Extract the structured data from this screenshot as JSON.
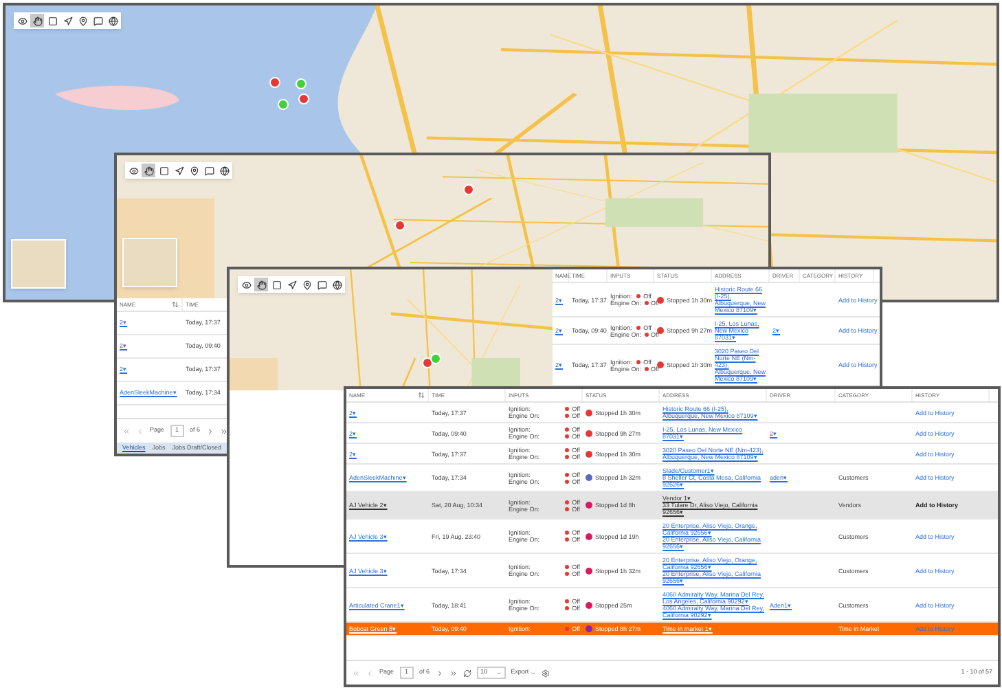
{
  "windows": [
    {
      "kind": "map_only",
      "tools": [
        {
          "selected": false
        },
        {
          "selected": true
        },
        {
          "selected": false
        },
        {
          "selected": false
        },
        {
          "selected": false
        },
        {
          "selected": false
        },
        {
          "selected": false
        }
      ],
      "markers": [
        {
          "color": "#e53935"
        },
        {
          "color": "#43d13a"
        },
        {
          "color": "#e53935"
        },
        {
          "color": "#43d13a"
        }
      ]
    },
    {
      "kind": "map_table",
      "tools": [
        {
          "selected": false
        },
        {
          "selected": true
        },
        {
          "selected": false
        },
        {
          "selected": false
        },
        {
          "selected": false
        },
        {
          "selected": false
        },
        {
          "selected": false
        }
      ],
      "markers": [
        {
          "color": "#e53935"
        },
        {
          "color": "#e53935"
        }
      ],
      "columns": [
        "NAME",
        "TIME"
      ],
      "rows": [
        {
          "name": "2▾",
          "time": "Today, 17:37"
        },
        {
          "name": "2▾",
          "time": "Today, 09:40"
        },
        {
          "name": "2▾",
          "time": "Today, 17:37"
        },
        {
          "name": "AdenSleekMachine▾",
          "time": "Today, 17:34"
        }
      ],
      "pager": {
        "page_label": "Page",
        "page": "1",
        "of": "of 6"
      },
      "tabs": [
        {
          "label": "Vehicles",
          "selected": true
        },
        {
          "label": "Jobs",
          "selected": false
        },
        {
          "label": "Jobs Draft/Closed",
          "selected": false
        }
      ]
    },
    {
      "kind": "split",
      "tools": [
        {
          "selected": false
        },
        {
          "selected": true
        },
        {
          "selected": false
        },
        {
          "selected": false
        },
        {
          "selected": false
        },
        {
          "selected": false
        },
        {
          "selected": false
        }
      ],
      "markers": [
        {
          "color": "#e53935"
        },
        {
          "color": "#43d13a"
        }
      ],
      "columns": [
        "NAME",
        "TIME",
        "INPUTS",
        "STATUS",
        "ADDRESS",
        "DRIVER",
        "CATEGORY",
        "HISTORY"
      ],
      "rows": [
        {
          "name": "2▾",
          "time": "Today, 17:37",
          "inputs": [
            {
              "label": "Ignition:",
              "value": "Off",
              "color": "#e53935"
            },
            {
              "label": "Engine On:",
              "value": "Off",
              "color": "#e53935"
            }
          ],
          "status": {
            "text": "Stopped 1h 30m",
            "color": "#e53935"
          },
          "address": [
            "Historic Route 66 (I-25), Albuquerque, New Mexico 87109▾"
          ],
          "history": "Add to History",
          "selected": false,
          "alert": false
        },
        {
          "name": "2▾",
          "time": "Today, 09:40",
          "inputs": [
            {
              "label": "Ignition:",
              "value": "Off",
              "color": "#e53935"
            },
            {
              "label": "Engine On:",
              "value": "Off",
              "color": "#e53935"
            }
          ],
          "status": {
            "text": "Stopped 9h 27m",
            "color": "#e53935"
          },
          "address": [
            "I-25, Los Lunas, New Mexico 87031▾"
          ],
          "driver": "2▾",
          "history": "Add to History",
          "selected": false,
          "alert": false
        },
        {
          "name": "2▾",
          "time": "Today, 17:37",
          "inputs": [
            {
              "label": "Ignition:",
              "value": "Off",
              "color": "#e53935"
            },
            {
              "label": "Engine On:",
              "value": "Off",
              "color": "#e53935"
            }
          ],
          "status": {
            "text": "Stopped 1h 30m",
            "color": "#e53935"
          },
          "address": [
            "3020 Paseo Del Norte NE (Nm-423), Albuquerque, New Mexico 87109▾"
          ],
          "history": "Add to History",
          "selected": false,
          "alert": false
        }
      ]
    },
    {
      "kind": "table",
      "columns": [
        "NAME",
        "TIME",
        "INPUTS",
        "STATUS",
        "ADDRESS",
        "DRIVER",
        "CATEGORY",
        "HISTORY"
      ],
      "rows": [
        {
          "name": "2▾",
          "time": "Today, 17:37",
          "inputs": [
            {
              "label": "Ignition:",
              "value": "Off",
              "color": "#e53935"
            },
            {
              "label": "Engine On:",
              "value": "Off",
              "color": "#e53935"
            }
          ],
          "status": {
            "text": "Stopped 1h 30m",
            "color": "#e53935"
          },
          "address": [
            "Historic Route 66 (I-25), Albuquerque, New Mexico 87109▾"
          ],
          "history": "Add to History",
          "selected": false,
          "alert": false
        },
        {
          "name": "2▾",
          "time": "Today, 09:40",
          "inputs": [
            {
              "label": "Ignition:",
              "value": "Off",
              "color": "#e53935"
            },
            {
              "label": "Engine On:",
              "value": "Off",
              "color": "#e53935"
            }
          ],
          "status": {
            "text": "Stopped 9h 27m",
            "color": "#e53935"
          },
          "address": [
            "I-25, Los Lunas, New Mexico 87031▾"
          ],
          "driver": "2▾",
          "history": "Add to History",
          "selected": false,
          "alert": false
        },
        {
          "name": "2▾",
          "time": "Today, 17:37",
          "inputs": [
            {
              "label": "Ignition:",
              "value": "Off",
              "color": "#e53935"
            },
            {
              "label": "Engine On:",
              "value": "Off",
              "color": "#e53935"
            }
          ],
          "status": {
            "text": "Stopped 1h 30m",
            "color": "#e53935"
          },
          "address": [
            "3020 Paseo Del Norte NE (Nm-423), Albuquerque, New Mexico 87109▾"
          ],
          "history": "Add to History",
          "selected": false,
          "alert": false
        },
        {
          "name": "AdenSleekMachine▾",
          "time": "Today, 17:34",
          "inputs": [
            {
              "label": "Ignition:",
              "value": "Off",
              "color": "#e53935"
            },
            {
              "label": "Engine On:",
              "value": "Off",
              "color": "#e53935"
            }
          ],
          "status": {
            "text": "Stopped 1h 32m",
            "color": "#5c6bc0"
          },
          "address": [
            "Slade/Customer1▾",
            "8 Sheller Ct, Costa Mesa, California 92626▾"
          ],
          "driver": "aden▾",
          "category": "Customers",
          "history": "Add to History",
          "selected": false,
          "alert": false
        },
        {
          "name": "AJ Vehicle 2▾",
          "time": "Sat, 20 Aug, 10:34",
          "inputs": [
            {
              "label": "Ignition:",
              "value": "Off",
              "color": "#e53935"
            },
            {
              "label": "Engine On:",
              "value": "Off",
              "color": "#e53935"
            }
          ],
          "status": {
            "text": "Stopped 1d 8h",
            "color": "#d81b60"
          },
          "address": [
            "Vendor 1▾",
            "33 Tulare Dr, Aliso Viejo, California 92656▾"
          ],
          "category": "Vendors",
          "history": "Add to History",
          "selected": true,
          "alert": false
        },
        {
          "name": "AJ Vehicle 3▾",
          "time": "Fri, 19 Aug, 23:40",
          "inputs": [
            {
              "label": "Ignition:",
              "value": "Off",
              "color": "#e53935"
            },
            {
              "label": "Engine On:",
              "value": "Off",
              "color": "#e53935"
            }
          ],
          "status": {
            "text": "Stopped 1d 19h",
            "color": "#d81b60"
          },
          "address": [
            "20 Enterprise, Aliso Viejo, Orange, California 92656▾",
            "20 Enterprise, Aliso Viejo, California 92656▾"
          ],
          "category": "Customers",
          "history": "Add to History",
          "selected": false,
          "alert": false
        },
        {
          "name": "AJ Vehicle 3▾",
          "time": "Today, 17:34",
          "inputs": [
            {
              "label": "Ignition:",
              "value": "Off",
              "color": "#e53935"
            },
            {
              "label": "Engine On:",
              "value": "Off",
              "color": "#e53935"
            }
          ],
          "status": {
            "text": "Stopped 1h 32m",
            "color": "#d81b60"
          },
          "address": [
            "20 Enterprise, Aliso Viejo, Orange, California 92656▾",
            "20 Enterprise, Aliso Viejo, California 92656▾"
          ],
          "category": "Customers",
          "history": "Add to History",
          "selected": false,
          "alert": false
        },
        {
          "name": "Articulated Crane1▾",
          "time": "Today, 18:41",
          "inputs": [
            {
              "label": "Ignition:",
              "value": "Off",
              "color": "#e53935"
            },
            {
              "label": "Engine On:",
              "value": "Off",
              "color": "#e53935"
            }
          ],
          "status": {
            "text": "Stopped 25m",
            "color": "#d81b60"
          },
          "address": [
            "4060 Admiralty Way, Marina Del Rey, Los Angeles, California 90292▾",
            "4060 Admiralty Way, Marina Del Rey, California 90292▾"
          ],
          "driver": "Aden1▾",
          "category": "Customers",
          "history": "Add to History",
          "selected": false,
          "alert": false
        },
        {
          "name": "Bobcat Green 5▾",
          "time": "Today, 09:40",
          "inputs": [
            {
              "label": "Ignition:",
              "value": "Off",
              "color": "#e53935"
            }
          ],
          "status": {
            "text": "Stopped 8h 27m",
            "color": "#8e24aa"
          },
          "address": [
            "Time in market 1▾"
          ],
          "category": "Time in Market",
          "history": "Add to History",
          "selected": false,
          "alert": true
        }
      ],
      "pager": {
        "page_label": "Page",
        "page": "1",
        "of": "of 6",
        "page_size": "10",
        "export": "Export",
        "summary": "1 - 10 of 57"
      }
    }
  ]
}
